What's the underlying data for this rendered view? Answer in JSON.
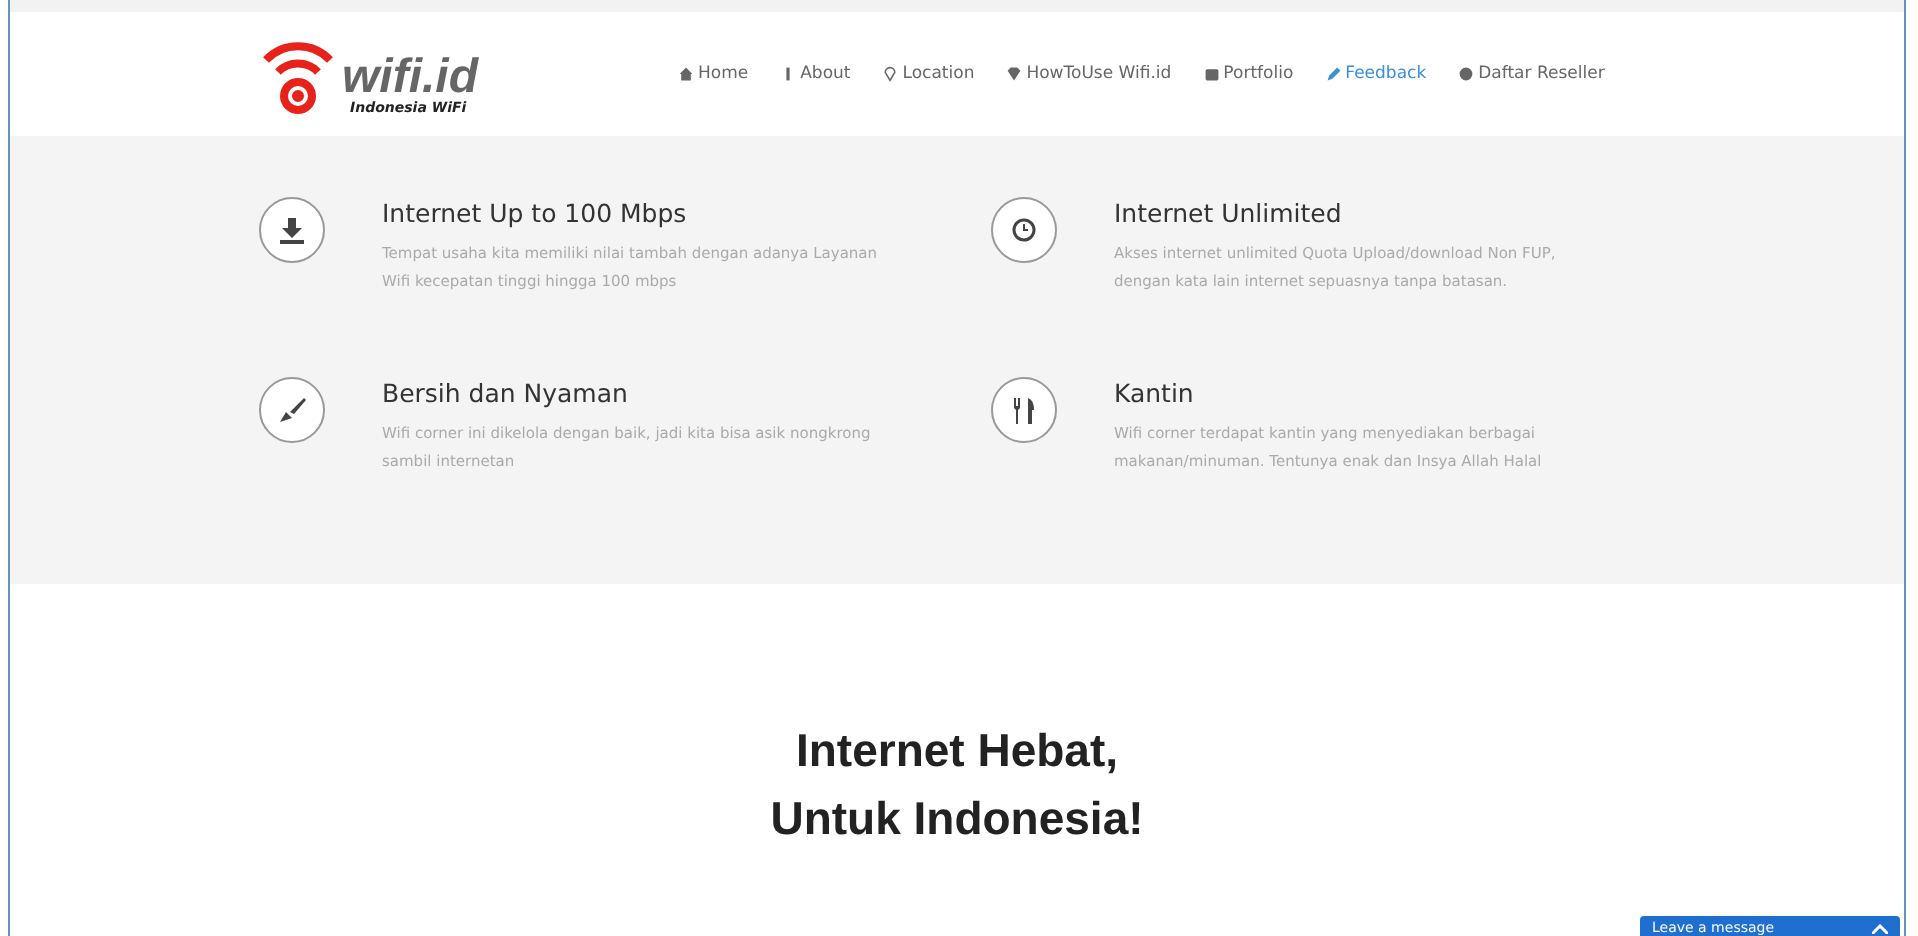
{
  "logo": {
    "text": "wifi.id",
    "tagline": "Indonesia WiFi"
  },
  "nav": [
    {
      "label": "Home",
      "selected": false
    },
    {
      "label": "About",
      "selected": false
    },
    {
      "label": "Location",
      "selected": false
    },
    {
      "label": "HowToUse Wifi.id",
      "selected": false
    },
    {
      "label": "Portfolio",
      "selected": false
    },
    {
      "label": "Feedback",
      "selected": true
    },
    {
      "label": "Daftar Reseller",
      "selected": false
    }
  ],
  "features": [
    {
      "title": "Internet Up to 100 Mbps",
      "text": "Tempat usaha kita memiliki nilai tambah dengan adanya Layanan Wifi kecepatan tinggi hingga 100 mbps"
    },
    {
      "title": "Internet Unlimited",
      "text": "Akses internet unlimited Quota Upload/download Non FUP, dengan kata lain internet sepuasnya tanpa batasan."
    },
    {
      "title": "Bersih dan Nyaman",
      "text": "Wifi corner ini dikelola dengan baik, jadi kita bisa asik nongkrong sambil internetan"
    },
    {
      "title": "Kantin",
      "text": "Wifi corner terdapat kantin yang menyediakan berbagai makanan/minuman. Tentunya enak dan Insya Allah Halal"
    }
  ],
  "headline": {
    "line1": "Internet **Hebat,**",
    "line2": "Untuk **Indonesia!**"
  },
  "chat_widget": {
    "label": "Leave a message"
  }
}
